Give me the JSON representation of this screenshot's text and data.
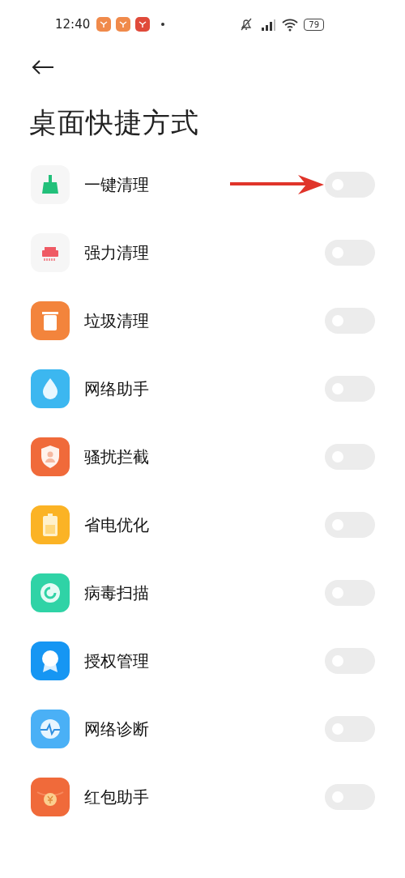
{
  "status_bar": {
    "time": "12:40",
    "battery": "79"
  },
  "title": "桌面快捷方式",
  "shortcuts": [
    {
      "label": "一键清理",
      "on": false
    },
    {
      "label": "强力清理",
      "on": false
    },
    {
      "label": "垃圾清理",
      "on": false
    },
    {
      "label": "网络助手",
      "on": false
    },
    {
      "label": "骚扰拦截",
      "on": false
    },
    {
      "label": "省电优化",
      "on": false
    },
    {
      "label": "病毒扫描",
      "on": false
    },
    {
      "label": "授权管理",
      "on": false
    },
    {
      "label": "网络诊断",
      "on": false
    },
    {
      "label": "红包助手",
      "on": false
    }
  ]
}
